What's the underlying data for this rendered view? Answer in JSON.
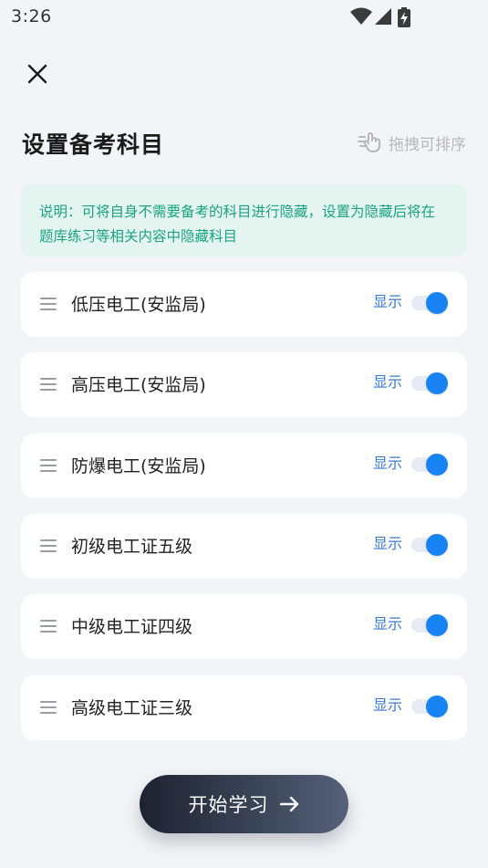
{
  "status_bar": {
    "time": "3:26",
    "icons": [
      "wifi-icon",
      "signal-icon",
      "battery-charging-icon"
    ]
  },
  "header": {
    "close_icon": "close-icon",
    "title": "设置备考科目",
    "drag_hint": "拖拽可排序",
    "drag_hint_icon": "drag-hand-icon"
  },
  "notice": {
    "text": "说明：可将自身不需要备考的科目进行隐藏，设置为隐藏后将在题库练习等相关内容中隐藏科目"
  },
  "subjects": [
    {
      "name": "低压电工(安监局)",
      "status_label": "显示",
      "enabled": true
    },
    {
      "name": "高压电工(安监局)",
      "status_label": "显示",
      "enabled": true
    },
    {
      "name": "防爆电工(安监局)",
      "status_label": "显示",
      "enabled": true
    },
    {
      "name": "初级电工证五级",
      "status_label": "显示",
      "enabled": true
    },
    {
      "name": "中级电工证四级",
      "status_label": "显示",
      "enabled": true
    },
    {
      "name": "高级电工证三级",
      "status_label": "显示",
      "enabled": true
    }
  ],
  "footer": {
    "start_button_label": "开始学习",
    "start_button_icon": "arrow-right-icon"
  },
  "colors": {
    "accent": "#1883f3",
    "notice_text": "#1aa384",
    "notice_bg": "#e4f4ef",
    "background": "#f3f4f7"
  }
}
